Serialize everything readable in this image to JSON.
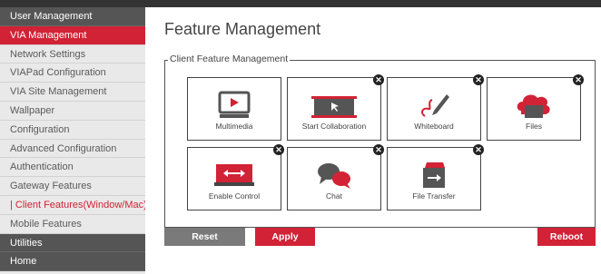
{
  "sidebar": {
    "items": [
      {
        "label": "User Management",
        "type": "section"
      },
      {
        "label": "VIA Management",
        "type": "active"
      },
      {
        "label": "Network Settings",
        "type": "normal"
      },
      {
        "label": "VIAPad Configuration",
        "type": "normal"
      },
      {
        "label": "VIA Site Management",
        "type": "normal"
      },
      {
        "label": "Wallpaper",
        "type": "normal"
      },
      {
        "label": "Configuration",
        "type": "normal"
      },
      {
        "label": "Advanced Configuration",
        "type": "normal"
      },
      {
        "label": "Authentication",
        "type": "normal"
      },
      {
        "label": "Gateway Features",
        "type": "normal"
      },
      {
        "label": "| Client Features(Window/Mac)",
        "type": "selected"
      },
      {
        "label": "Mobile Features",
        "type": "normal"
      },
      {
        "label": "Utilities",
        "type": "section"
      },
      {
        "label": "Home",
        "type": "section"
      }
    ]
  },
  "main": {
    "title": "Feature Management",
    "legend": "Client Feature Management",
    "tiles": [
      {
        "label": "Multimedia",
        "icon": "multimedia-icon"
      },
      {
        "label": "Start Collaboration",
        "icon": "collaboration-icon"
      },
      {
        "label": "Whiteboard",
        "icon": "whiteboard-icon"
      },
      {
        "label": "Files",
        "icon": "files-icon"
      },
      {
        "label": "Enable Control",
        "icon": "enable-control-icon"
      },
      {
        "label": "Chat",
        "icon": "chat-icon"
      },
      {
        "label": "File Transfer",
        "icon": "file-transfer-icon"
      }
    ],
    "close_glyph": "✕"
  },
  "buttons": {
    "reset": "Reset",
    "apply": "Apply",
    "reboot": "Reboot"
  },
  "colors": {
    "accent": "#d22235",
    "section_bg": "#555555",
    "sidebar_bg": "#e9e9e9",
    "reset_bg": "#7a7a7a"
  }
}
